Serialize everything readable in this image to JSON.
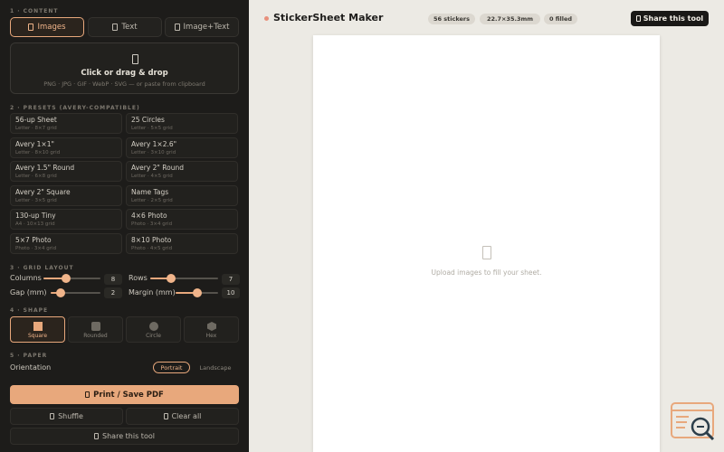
{
  "sidebar": {
    "sections": {
      "content": "1 · CONTENT",
      "presets": "2 · PRESETS (AVERY-COMPATIBLE)",
      "grid": "3 · GRID LAYOUT",
      "shape": "4 · SHAPE",
      "paper": "5 · PAPER"
    },
    "tabs": [
      {
        "label": "Images",
        "active": true
      },
      {
        "label": "Text",
        "active": false
      },
      {
        "label": "Image+Text",
        "active": false
      }
    ],
    "dropzone": {
      "title": "Click or drag & drop",
      "subtitle": "PNG · JPG · GIF · WebP · SVG — or paste from clipboard"
    },
    "presets": [
      {
        "name": "56-up Sheet",
        "detail": "Letter · 8×7 grid"
      },
      {
        "name": "25 Circles",
        "detail": "Letter · 5×5 grid"
      },
      {
        "name": "Avery 1×1\"",
        "detail": "Letter · 8×10 grid"
      },
      {
        "name": "Avery 1×2.6\"",
        "detail": "Letter · 3×10 grid"
      },
      {
        "name": "Avery 1.5\" Round",
        "detail": "Letter · 6×8 grid"
      },
      {
        "name": "Avery 2\" Round",
        "detail": "Letter · 4×5 grid"
      },
      {
        "name": "Avery 2\" Square",
        "detail": "Letter · 3×5 grid"
      },
      {
        "name": "Name Tags",
        "detail": "Letter · 2×5 grid"
      },
      {
        "name": "130-up Tiny",
        "detail": "A4 · 10×13 grid"
      },
      {
        "name": "4×6 Photo",
        "detail": "Photo · 3×4 grid"
      },
      {
        "name": "5×7 Photo",
        "detail": "Photo · 3×4 grid"
      },
      {
        "name": "8×10 Photo",
        "detail": "Photo · 4×5 grid"
      }
    ],
    "grid": {
      "columns": {
        "label": "Columns",
        "value": 8,
        "fraction": 0.4
      },
      "rows": {
        "label": "Rows",
        "value": 7,
        "fraction": 0.3
      },
      "gap": {
        "label": "Gap (mm)",
        "value": 2,
        "fraction": 0.2
      },
      "margin": {
        "label": "Margin (mm)",
        "value": 10,
        "fraction": 0.5
      }
    },
    "shapes": [
      {
        "label": "Square",
        "active": true
      },
      {
        "label": "Rounded",
        "active": false
      },
      {
        "label": "Circle",
        "active": false
      },
      {
        "label": "Hex",
        "active": false
      }
    ],
    "paper": {
      "orientation_label": "Orientation",
      "options": [
        {
          "label": "Portrait",
          "active": true
        },
        {
          "label": "Landscape",
          "active": false
        }
      ]
    },
    "actions": {
      "print": "Print / Save PDF",
      "shuffle": "Shuffle",
      "clear": "Clear all",
      "share": "Share this tool"
    }
  },
  "header": {
    "title": "StickerSheet Maker",
    "badges": [
      "56 stickers",
      "22.7×35.3mm",
      "0 filled"
    ],
    "share": "Share this tool"
  },
  "sheet": {
    "empty_text": "Upload images to fill your sheet."
  },
  "colors": {
    "accent": "#e8a87c",
    "sidebar_bg": "#1d1c1a",
    "main_bg": "#eceae4"
  }
}
